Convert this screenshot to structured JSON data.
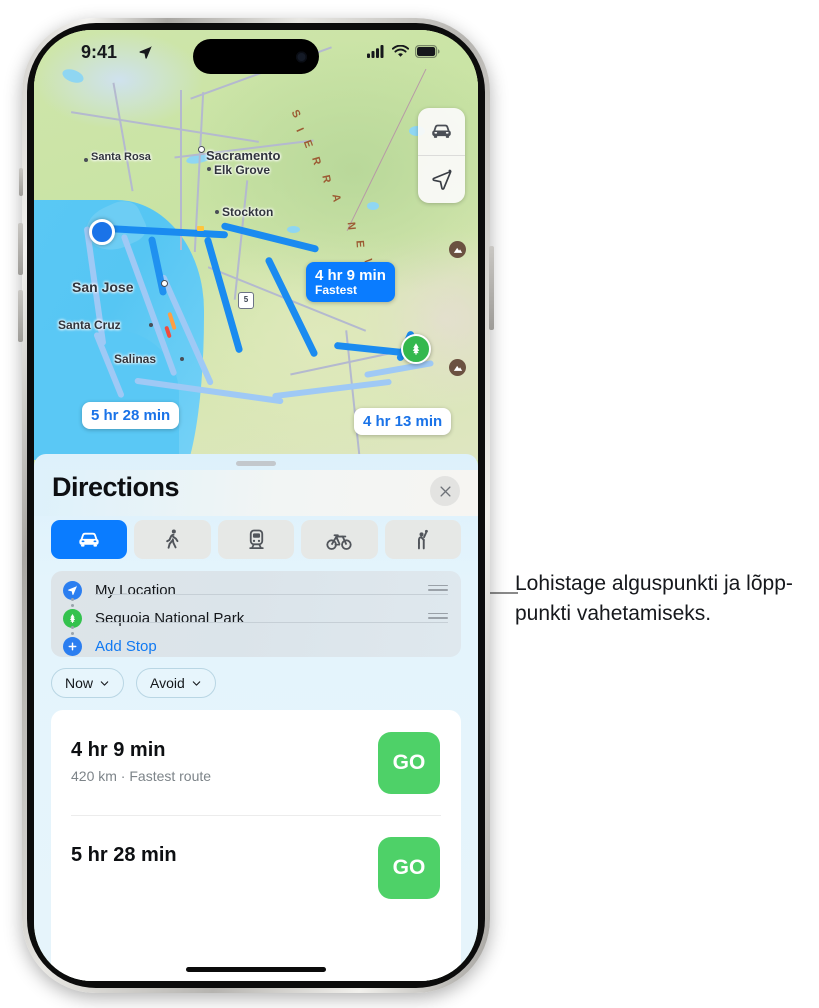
{
  "status_bar": {
    "time": "9:41",
    "location_arrow_icon": "location-arrow-icon",
    "cellular_icon": "cellular-bars-icon",
    "wifi_icon": "wifi-icon",
    "battery_icon": "battery-full-icon"
  },
  "map": {
    "controls": [
      {
        "name": "drive-mode-button",
        "icon": "car-icon"
      },
      {
        "name": "locate-me-button",
        "icon": "navigation-arrow-icon"
      }
    ],
    "labels": [
      {
        "text": "Santa Rosa",
        "size": 11
      },
      {
        "text": "Sacramento",
        "size": 13
      },
      {
        "text": "Elk Grove",
        "size": 12
      },
      {
        "text": "Stockton",
        "size": 12
      },
      {
        "text": "San Jose",
        "size": 14
      },
      {
        "text": "Santa Cruz",
        "size": 12
      },
      {
        "text": "Salinas",
        "size": 12
      }
    ],
    "region_label": "SIERRA NEV",
    "highway_shields": [
      "5",
      "5"
    ],
    "origin_marker": "current-location-dot",
    "destination_marker": "park-tree-pin",
    "route_bubbles": [
      {
        "name": "route-bubble-fastest",
        "time": "4 hr 9 min",
        "sub": "Fastest",
        "style": "blue"
      },
      {
        "name": "route-bubble-alt-1",
        "time": "5 hr 28 min",
        "sub": "",
        "style": "white"
      },
      {
        "name": "route-bubble-alt-2",
        "time": "4 hr 13 min",
        "sub": "",
        "style": "white"
      }
    ],
    "poi_badges": [
      "mountain-badge",
      "mountain-badge"
    ]
  },
  "sheet": {
    "title": "Directions",
    "close_label": "×",
    "modes": [
      {
        "name": "mode-drive",
        "icon": "car-icon",
        "active": true
      },
      {
        "name": "mode-walk",
        "icon": "walk-icon",
        "active": false
      },
      {
        "name": "mode-transit",
        "icon": "train-icon",
        "active": false
      },
      {
        "name": "mode-cycle",
        "icon": "bicycle-icon",
        "active": false
      },
      {
        "name": "mode-rideshare",
        "icon": "rideshare-icon",
        "active": false
      }
    ],
    "route_points": [
      {
        "name": "route-point-origin",
        "label": "My Location",
        "icon": "navigation-arrow-icon",
        "draggable": true
      },
      {
        "name": "route-point-destination",
        "label": "Sequoia National Park",
        "icon": "park-tree-icon",
        "draggable": true
      },
      {
        "name": "route-point-add-stop",
        "label": "Add Stop",
        "icon": "plus-icon",
        "draggable": false
      }
    ],
    "chips": [
      {
        "name": "departure-time-chip",
        "label": "Now"
      },
      {
        "name": "avoid-chip",
        "label": "Avoid"
      }
    ],
    "routes": [
      {
        "duration": "4 hr 9 min",
        "meta": "420 km · Fastest route",
        "go_label": "GO"
      },
      {
        "duration": "5 hr 28 min",
        "meta": "",
        "go_label": "GO"
      }
    ]
  },
  "callout": {
    "text": "Lohistage alguspunkti ja lõpp-punkti vahetamiseks."
  },
  "colors": {
    "accent_blue": "#0a7cff",
    "go_green": "#4ed168",
    "park_green": "#34b84e",
    "sheet_bg": "#e6f4fb"
  }
}
